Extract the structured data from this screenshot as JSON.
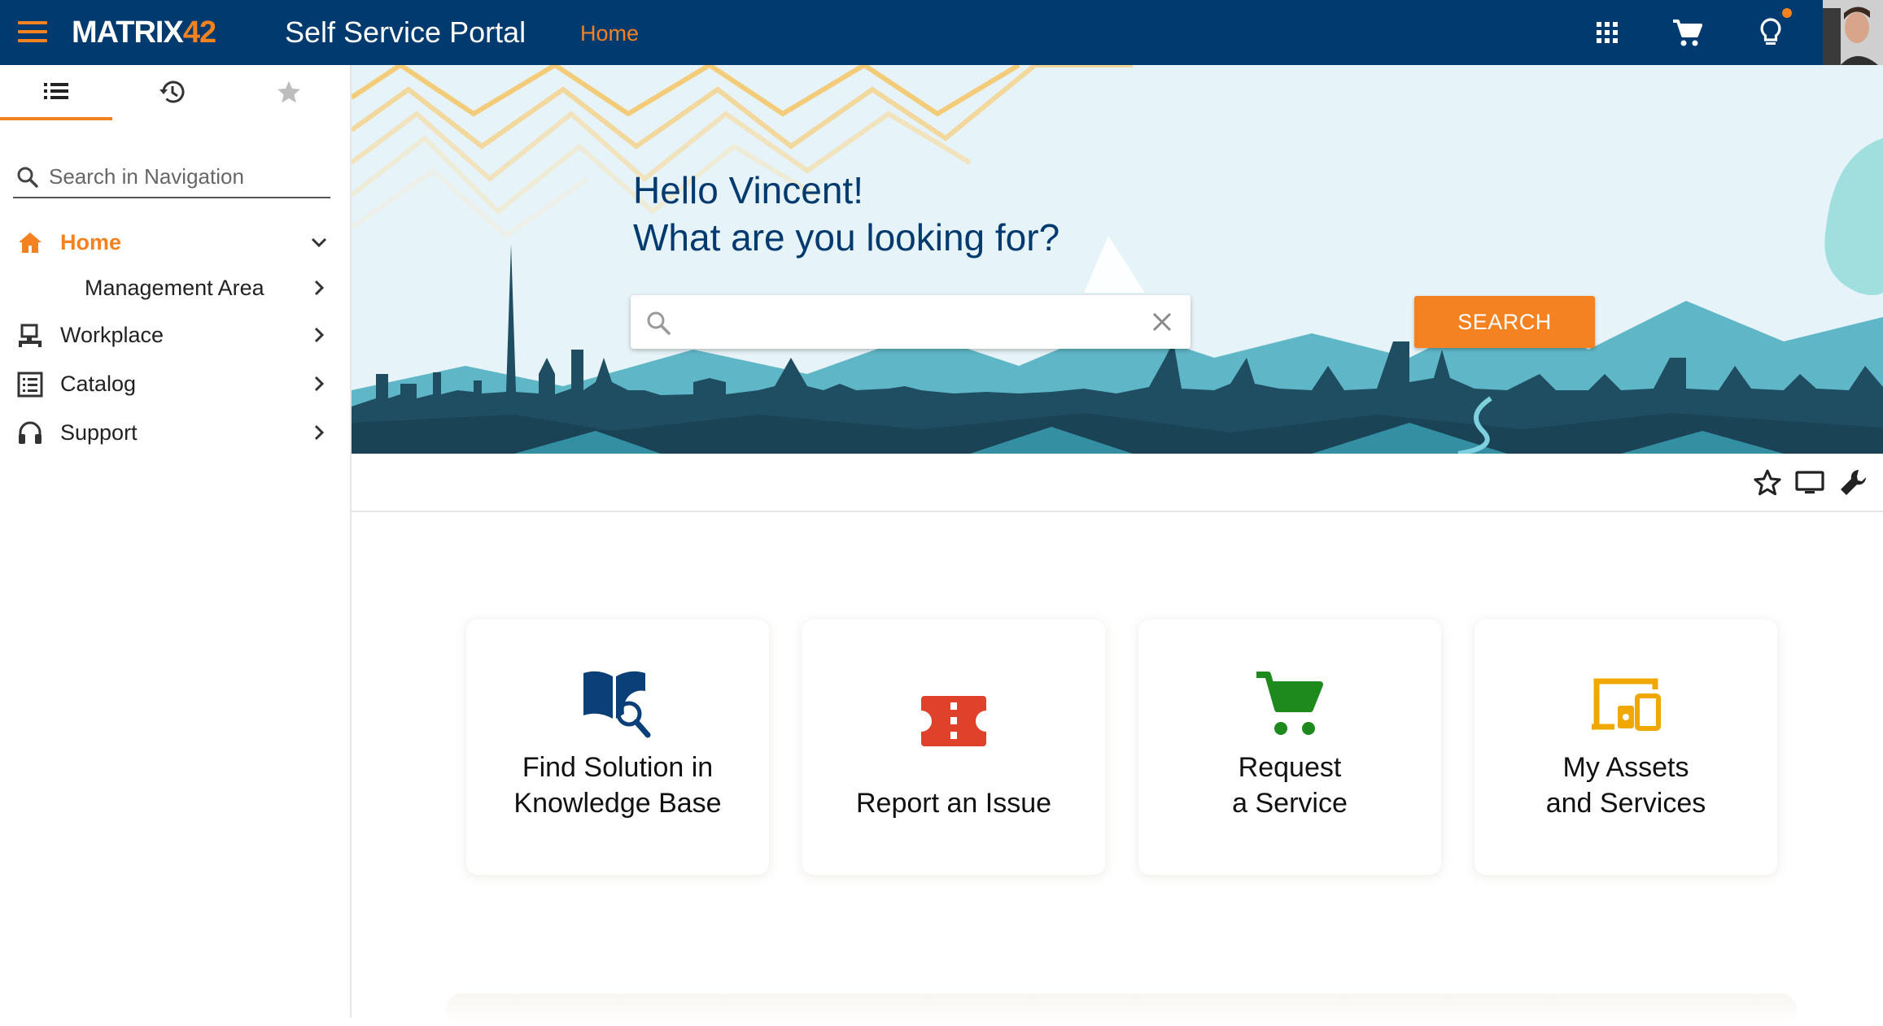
{
  "header": {
    "logo_part1": "MATRIX",
    "logo_part2": "42",
    "app_title": "Self Service Portal",
    "breadcrumb": "Home",
    "accent_color": "#f58220",
    "bar_color": "#003a6e"
  },
  "sidebar": {
    "tabs": [
      {
        "icon": "list-icon"
      },
      {
        "icon": "history-icon"
      },
      {
        "icon": "star-icon"
      }
    ],
    "search_placeholder": "Search in Navigation",
    "items": [
      {
        "label": "Home",
        "icon": "home-icon",
        "expanded": true
      },
      {
        "label": "Management Area",
        "icon": "",
        "sub": true
      },
      {
        "label": "Workplace",
        "icon": "workplace-icon"
      },
      {
        "label": "Catalog",
        "icon": "catalog-icon"
      },
      {
        "label": "Support",
        "icon": "headset-icon"
      }
    ]
  },
  "hero": {
    "greeting_line1": "Hello Vincent!",
    "greeting_line2": "What are you looking for?",
    "search_value": "",
    "search_button": "SEARCH"
  },
  "tiles": [
    {
      "line1": "Find Solution in",
      "line2": "Knowledge Base",
      "icon": "book-search-icon",
      "color": "#0b3f78"
    },
    {
      "line1": "",
      "line2": "Report an Issue",
      "icon": "ticket-icon",
      "color": "#e0412a"
    },
    {
      "line1": "Request",
      "line2": "a Service",
      "icon": "cart-icon",
      "color": "#1e8a1e"
    },
    {
      "line1": "My Assets",
      "line2": "and Services",
      "icon": "devices-icon",
      "color": "#f0a800"
    }
  ]
}
